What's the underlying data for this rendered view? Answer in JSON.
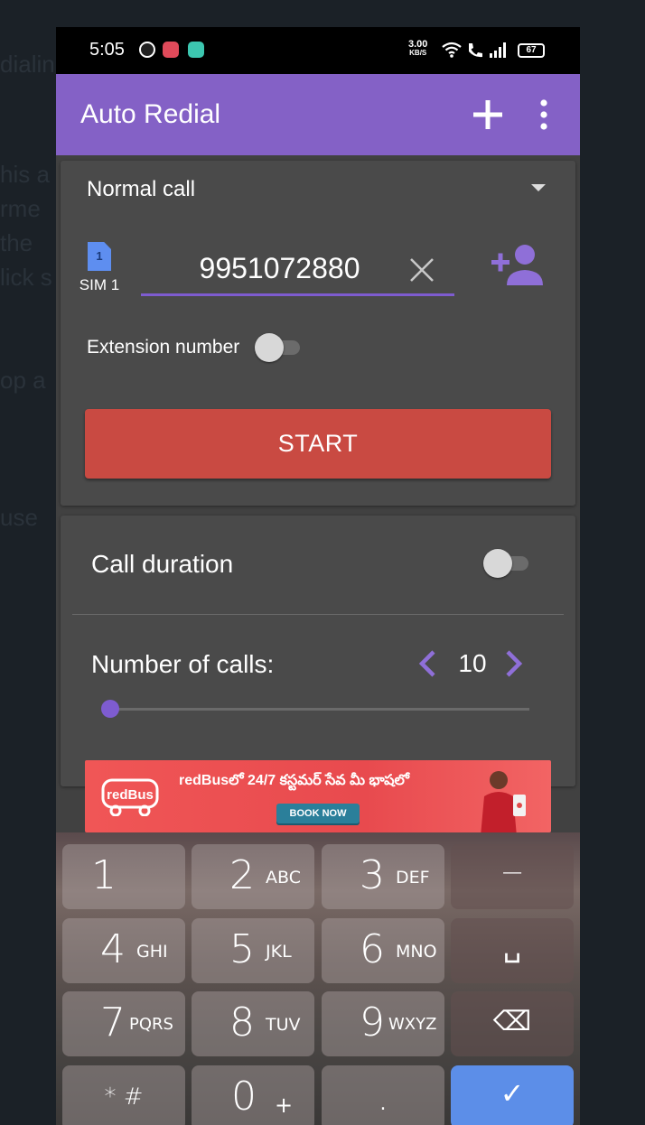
{
  "status_bar": {
    "time": "5:05",
    "net_speed_value": "3.00",
    "net_speed_unit": "KB/S",
    "battery": "67"
  },
  "app_bar": {
    "title": "Auto Redial",
    "add_icon": "plus-icon",
    "more_icon": "more-vert-icon"
  },
  "call_form": {
    "call_type": "Normal call",
    "sim_badge": "1",
    "sim_label": "SIM 1",
    "phone_number": "9951072880",
    "extension_label": "Extension number",
    "extension_enabled": false,
    "start_label": "START"
  },
  "settings": {
    "call_duration_label": "Call duration",
    "call_duration_enabled": false,
    "number_of_calls_label": "Number of calls:",
    "number_of_calls_value": "10",
    "slider_fraction": 0
  },
  "ad": {
    "logo_text": "redBus",
    "text": "redBusలో 24/7 కస్టమర్ సేవ మీ భాషలో",
    "button": "BOOK NOW"
  },
  "keypad": {
    "keys": [
      {
        "digit": "1",
        "letters": ""
      },
      {
        "digit": "2",
        "letters": "ABC"
      },
      {
        "digit": "3",
        "letters": "DEF"
      },
      {
        "digit": "−",
        "letters": ""
      },
      {
        "digit": "4",
        "letters": "GHI"
      },
      {
        "digit": "5",
        "letters": "JKL"
      },
      {
        "digit": "6",
        "letters": "MNO"
      },
      {
        "digit": "␣",
        "letters": ""
      },
      {
        "digit": "7",
        "letters": "PQRS"
      },
      {
        "digit": "8",
        "letters": "TUV"
      },
      {
        "digit": "9",
        "letters": "WXYZ"
      },
      {
        "digit": "⌫",
        "letters": ""
      },
      {
        "digit": "* #",
        "letters": ""
      },
      {
        "digit": "0",
        "letters": "+"
      },
      {
        "digit": ".",
        "letters": ""
      },
      {
        "digit": "✓",
        "letters": ""
      }
    ]
  },
  "colors": {
    "accent": "#8461c6",
    "start_button": "#c94a42",
    "card_background": "#4a4a4a",
    "keyboard_done": "#5c8ee8"
  }
}
